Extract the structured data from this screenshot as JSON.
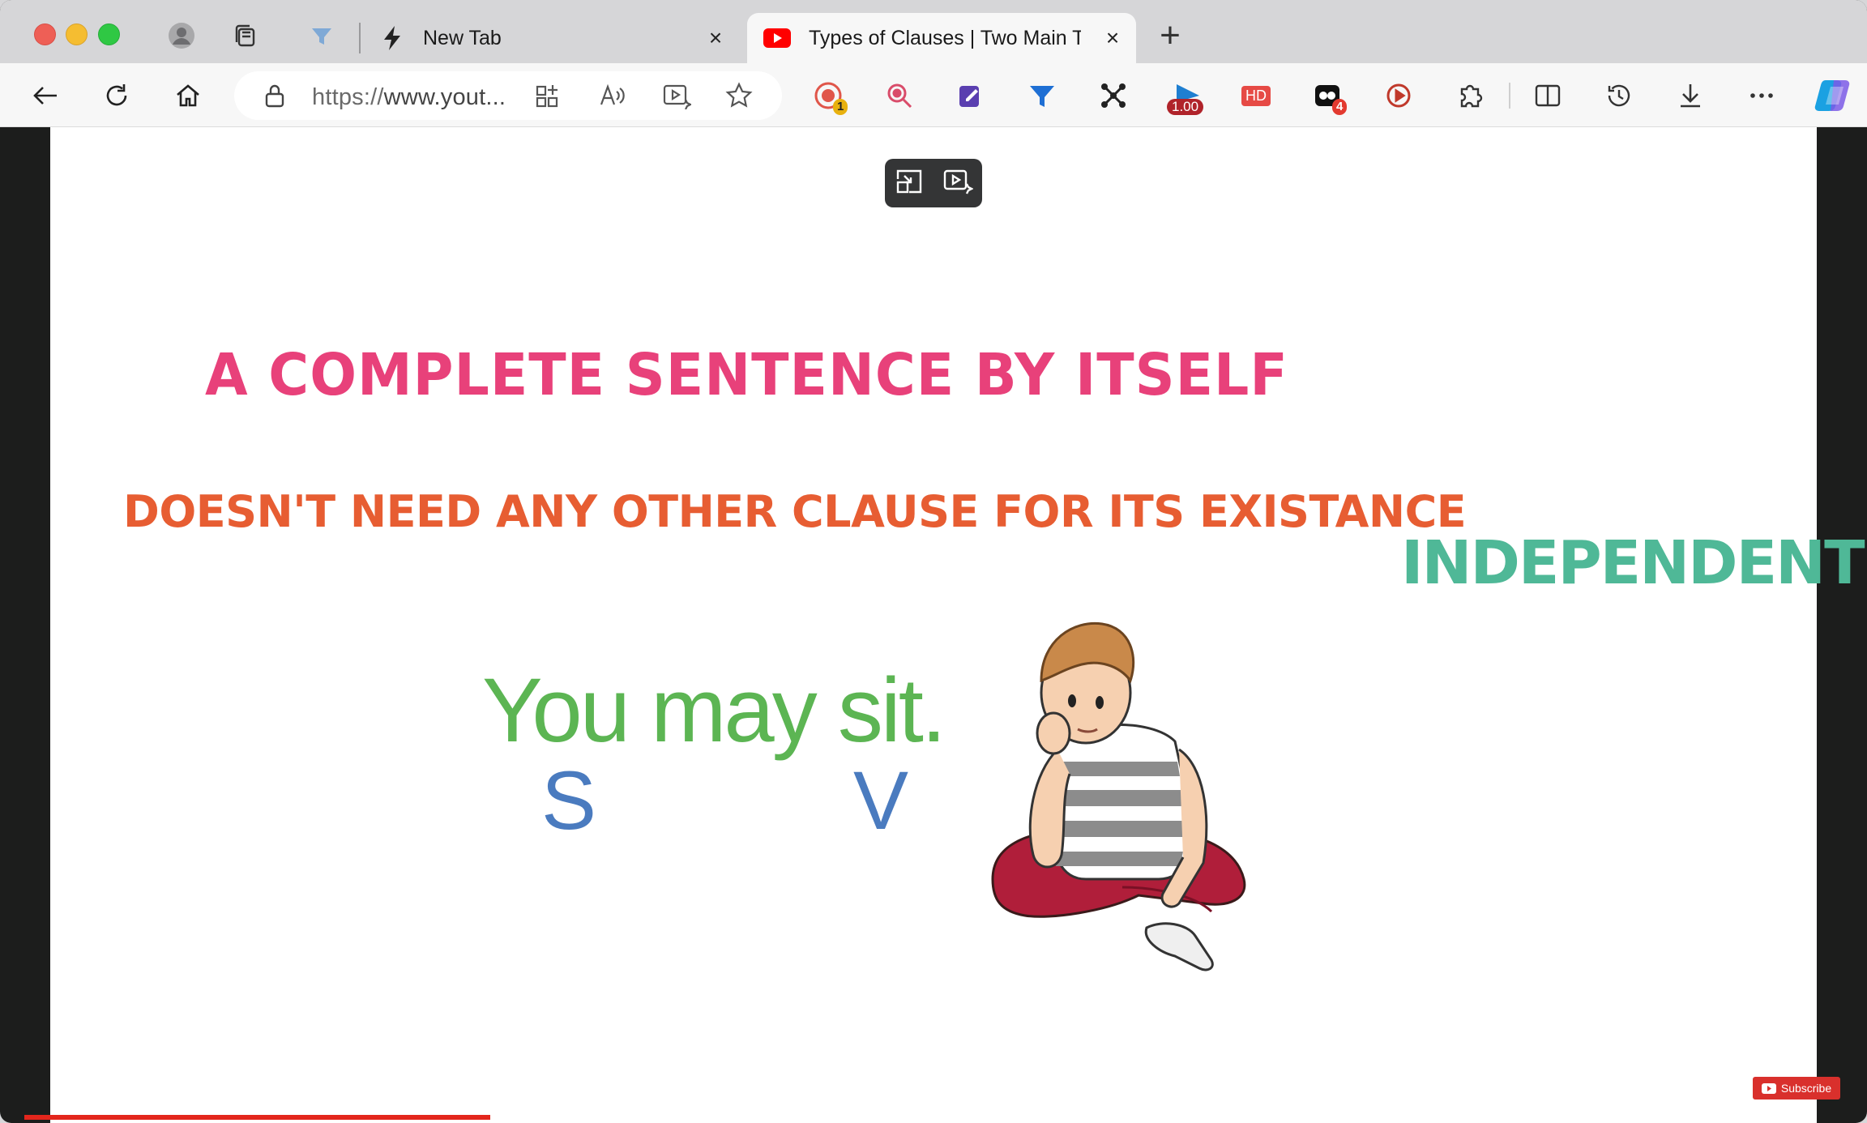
{
  "window": {
    "tabs": [
      {
        "label": "New Tab",
        "icon": "lightning-icon",
        "active": false
      },
      {
        "label": "Types of Clauses | Two Main Ty",
        "icon": "youtube-icon",
        "active": true
      }
    ]
  },
  "toolbar": {
    "url_scheme": "https://",
    "url_rest": "www.yout...",
    "extension_badges": {
      "record": "1",
      "speed": "1.00",
      "hd": "HD",
      "cam": "4"
    }
  },
  "video": {
    "headline": "A COMPLETE SENTENCE BY ITSELF",
    "subline": "DOESN'T NEED ANY OTHER CLAUSE FOR ITS EXISTANCE",
    "tag": "INDEPENDENT",
    "example_sentence": "You may sit.",
    "subject_label": "S",
    "verb_label": "V",
    "subscribe_label": "Subscribe",
    "progress": 0.25
  },
  "colors": {
    "headline": "#e8417a",
    "subline": "#e75d32",
    "tag": "#4fb897",
    "example": "#5cb553",
    "labels": "#4a7bbf",
    "progress": "#e3261c"
  }
}
